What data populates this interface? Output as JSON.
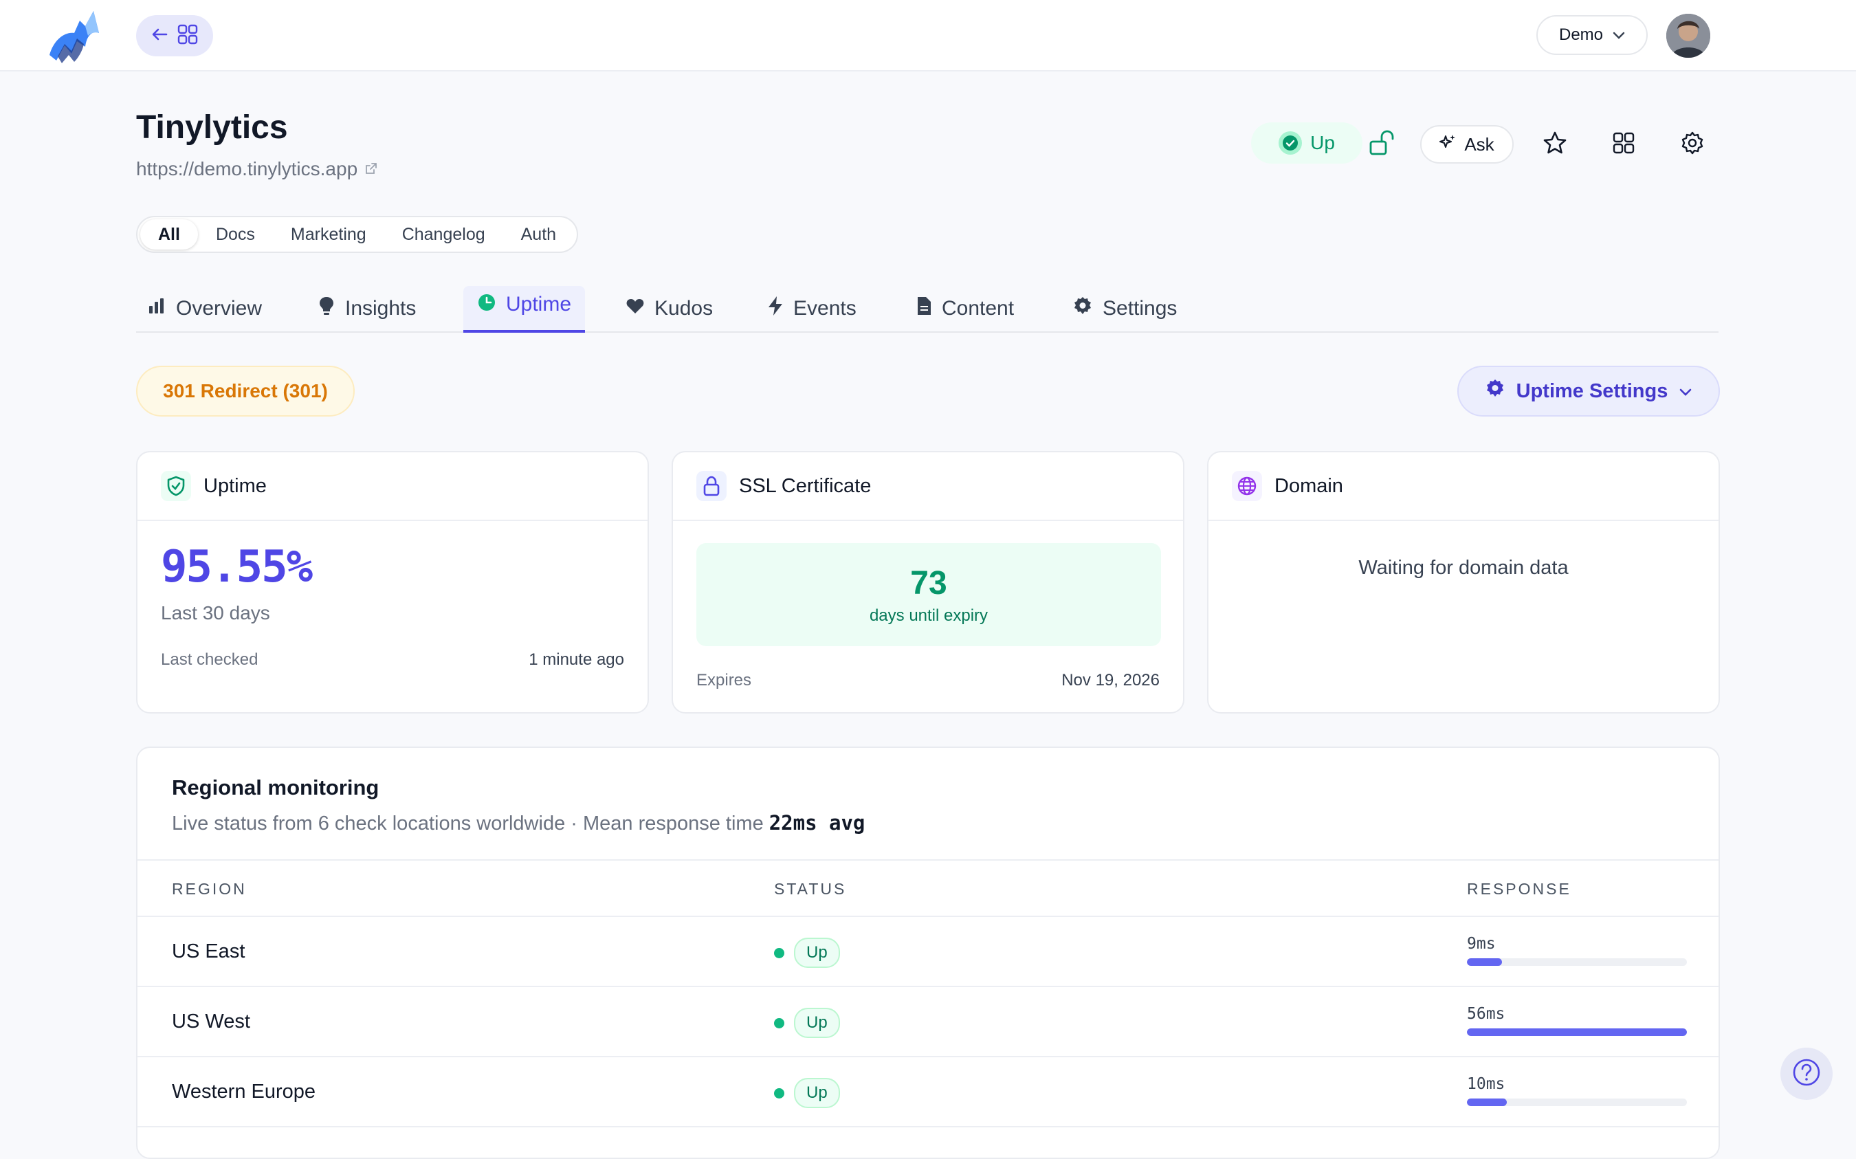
{
  "topbar": {
    "workspace_select": "Demo",
    "icons": [
      "logo",
      "arrow-left-icon",
      "grid-icon",
      "chevron-down-icon",
      "avatar"
    ]
  },
  "site": {
    "title": "Tinylytics",
    "url": "https://demo.tinylytics.app",
    "status": "Up",
    "ask_label": "Ask"
  },
  "filters": {
    "items": [
      "All",
      "Docs",
      "Marketing",
      "Changelog",
      "Auth"
    ],
    "selected": "All"
  },
  "tabs": [
    {
      "label": "Overview",
      "icon": "bar-chart-icon"
    },
    {
      "label": "Insights",
      "icon": "lightbulb-icon"
    },
    {
      "label": "Uptime",
      "icon": "clock-icon",
      "active": true
    },
    {
      "label": "Kudos",
      "icon": "heart-icon"
    },
    {
      "label": "Events",
      "icon": "bolt-icon"
    },
    {
      "label": "Content",
      "icon": "document-icon"
    },
    {
      "label": "Settings",
      "icon": "gear-icon"
    }
  ],
  "redirect_badge": "301 Redirect (301)",
  "uptime_settings_label": "Uptime Settings",
  "cards": {
    "uptime": {
      "title": "Uptime",
      "percent": "95.55%",
      "period": "Last 30 days",
      "last_checked_label": "Last checked",
      "last_checked_value": "1 minute ago"
    },
    "ssl": {
      "title": "SSL Certificate",
      "days": "73",
      "days_label": "days until expiry",
      "expires_label": "Expires",
      "expires_value": "Nov 19, 2026"
    },
    "domain": {
      "title": "Domain",
      "message": "Waiting for domain data"
    }
  },
  "regional": {
    "title": "Regional monitoring",
    "subtitle": "Live status from 6 check locations worldwide · Mean response time",
    "mean": "22ms avg",
    "headers": {
      "region": "REGION",
      "status": "STATUS",
      "response": "RESPONSE"
    },
    "rows": [
      {
        "region": "US East",
        "status": "Up",
        "response": "9ms",
        "bar_fraction": 0.16
      },
      {
        "region": "US West",
        "status": "Up",
        "response": "56ms",
        "bar_fraction": 1.0
      },
      {
        "region": "Western Europe",
        "status": "Up",
        "response": "10ms",
        "bar_fraction": 0.18
      }
    ]
  },
  "colors": {
    "accent": "#4f46e5",
    "success": "#059669",
    "warning": "#d97706"
  }
}
